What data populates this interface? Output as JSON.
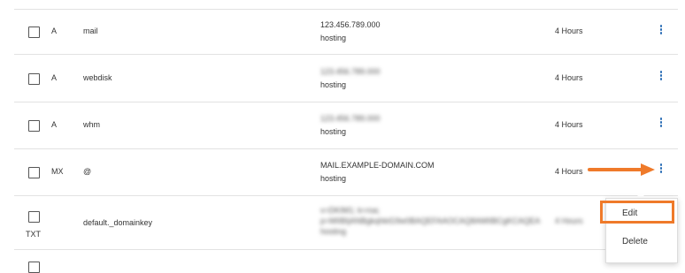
{
  "rows": [
    {
      "type": "A",
      "name": "mail",
      "value_line1": "123.456.789.000",
      "value_line2": "hosting",
      "ttl": "4 Hours"
    },
    {
      "type": "A",
      "name": "webdisk",
      "value_line1": "123.456.789.000",
      "value_line2": "hosting",
      "ttl": "4 Hours"
    },
    {
      "type": "A",
      "name": "whm",
      "value_line1": "123.456.789.000",
      "value_line2": "hosting",
      "ttl": "4 Hours"
    },
    {
      "type": "MX",
      "name": "@",
      "value_line1": "MAIL.EXAMPLE-DOMAIN.COM",
      "value_line2": "hosting",
      "ttl": "4 Hours"
    },
    {
      "type": "TXT",
      "name": "default._domainkey",
      "value_line1": "v=DKIM1; k=rsa;",
      "value_line2": "p=MIIBIjANBgkqhkiG9w0BAQEFAAOCAQ8AMIIBCgKCAQEA",
      "value_line3": "hosting",
      "ttl": "4 Hours"
    }
  ],
  "menu": {
    "edit_label": "Edit",
    "delete_label": "Delete"
  },
  "colors": {
    "accent": "#2a6db5",
    "highlight": "#ef7a2a"
  },
  "icons": {
    "row_actions": "kebab-menu-icon",
    "pointer": "arrow-right-icon"
  }
}
